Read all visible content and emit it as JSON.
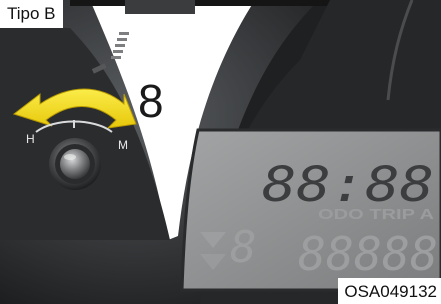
{
  "caption": {
    "tag": "Tipo B",
    "code": "OSA049132"
  },
  "dial": {
    "numeral": "8"
  },
  "knob": {
    "left_mark": "H",
    "right_mark": "M"
  },
  "lcd": {
    "clock": "88:88",
    "ghost_labels": "ODO TRIP A",
    "ghost_digits": "88888"
  },
  "colors": {
    "arrow": "#f4dc1a",
    "bezel": "#3a3c3e",
    "lcd_bg": "#8c8e8f",
    "lcd_digit": "#3d3e40",
    "dial_face": "#ffffff"
  }
}
